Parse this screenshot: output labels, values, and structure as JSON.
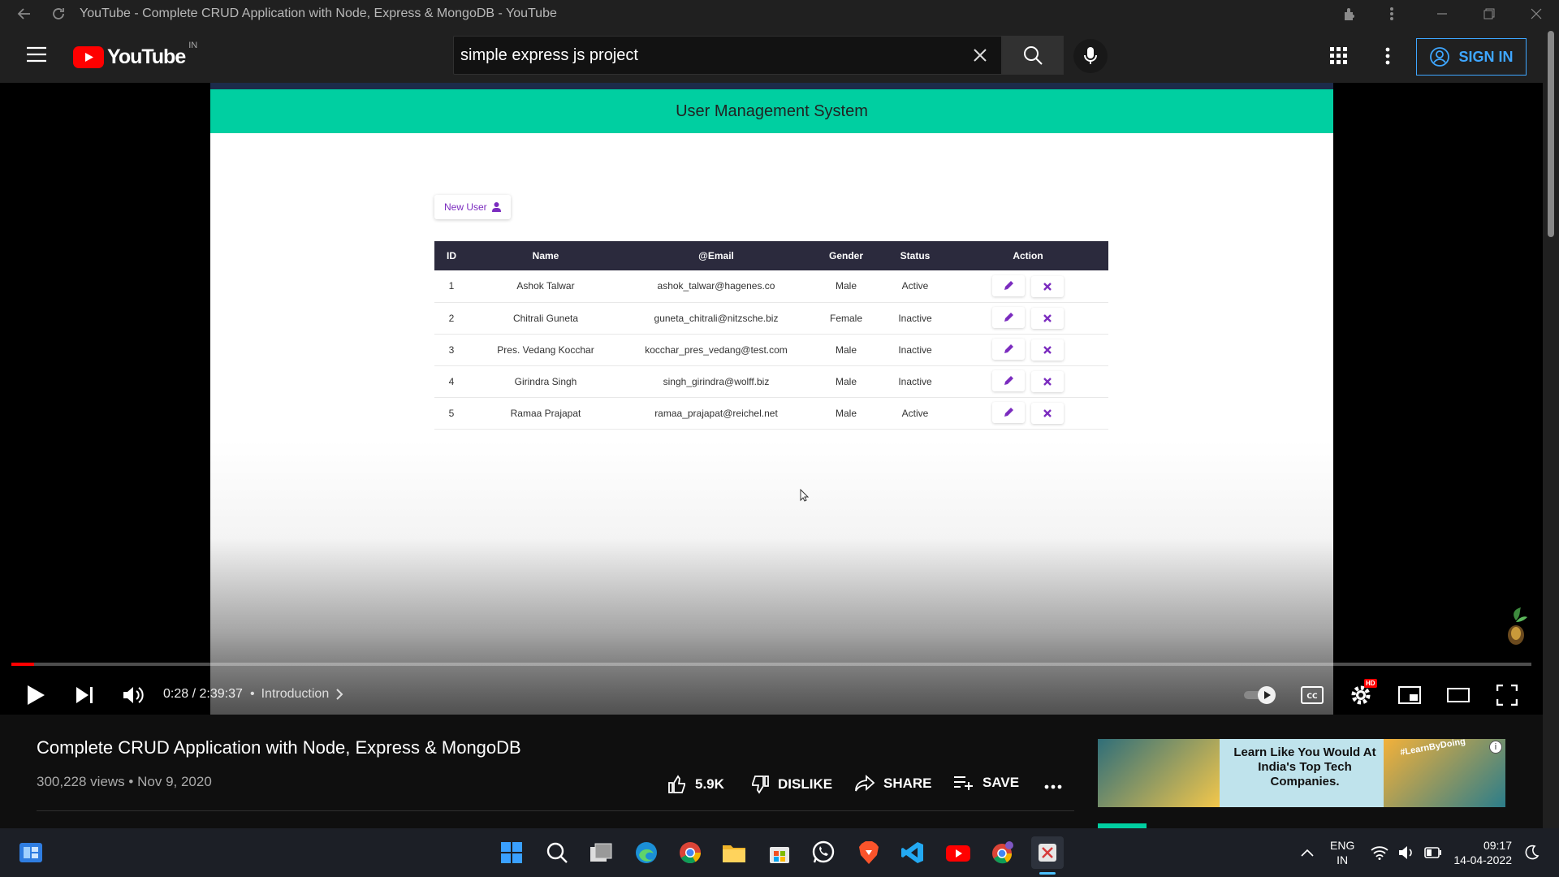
{
  "browser": {
    "window_title": "YouTube - Complete CRUD Application with Node, Express & MongoDB - YouTube"
  },
  "masthead": {
    "logo_text": "YouTube",
    "country_code": "IN",
    "search_value": "simple express js project",
    "sign_in_label": "SIGN IN"
  },
  "video_content": {
    "app_title": "User Management System",
    "new_user_label": "New User",
    "table": {
      "headers": [
        "ID",
        "Name",
        "@Email",
        "Gender",
        "Status",
        "Action"
      ],
      "rows": [
        [
          "1",
          "Ashok Talwar",
          "ashok_talwar@hagenes.co",
          "Male",
          "Active"
        ],
        [
          "2",
          "Chitrali Guneta",
          "guneta_chitrali@nitzsche.biz",
          "Female",
          "Inactive"
        ],
        [
          "3",
          "Pres. Vedang Kocchar",
          "kocchar_pres_vedang@test.com",
          "Male",
          "Inactive"
        ],
        [
          "4",
          "Girindra Singh",
          "singh_girindra@wolff.biz",
          "Male",
          "Inactive"
        ],
        [
          "5",
          "Ramaa Prajapat",
          "ramaa_prajapat@reichel.net",
          "Male",
          "Active"
        ]
      ]
    }
  },
  "player": {
    "current_time": "0:28",
    "duration": "2:39:37",
    "time_display": "0:28 / 2:39:37",
    "chapter": "Introduction",
    "progress_fraction": 0.0029,
    "hd_badge": "HD"
  },
  "video_info": {
    "title": "Complete CRUD Application with Node, Express & MongoDB",
    "views": "300,228 views",
    "date": "Nov 9, 2020",
    "likes": "5.9K",
    "dislike_label": "DISLIKE",
    "share_label": "SHARE",
    "save_label": "SAVE"
  },
  "ad": {
    "headline": "Learn Like You Would At India's Top Tech Companies.",
    "tag": "#LearnByDoing",
    "info": "i"
  },
  "taskbar": {
    "lang": "ENG",
    "region": "IN",
    "time": "09:17",
    "date": "14-04-2022"
  },
  "colors": {
    "youtube_red": "#ff0000",
    "app_header": "#00cfa1",
    "accent_purple": "#7b2cbf",
    "sign_in_blue": "#3ea6ff"
  }
}
